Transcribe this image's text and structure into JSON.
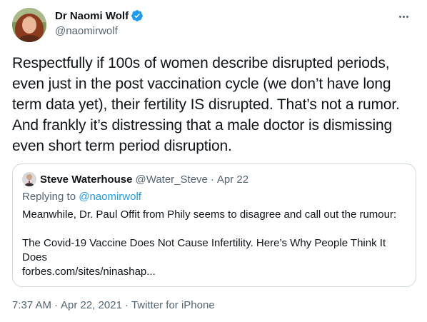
{
  "author": {
    "display_name": "Dr Naomi Wolf",
    "handle": "@naomirwolf",
    "verified_icon": "verified-badge-icon",
    "avatar": "avatar"
  },
  "tweet": {
    "text": "Respectfully if 100s of women describe disrupted periods, even just in the post vaccination cycle (we don’t have long term data yet), their fertility IS disrupted. That’s not a rumor. And frankly it’s distressing that a male doctor is dismissing even short term period disruption."
  },
  "quoted_tweet": {
    "display_name": "Steve Waterhouse",
    "handle": "@Water_Steve",
    "separator": "·",
    "date": "Apr 22",
    "replying_to_prefix": "Replying to",
    "replying_to_handle": "@naomirwolf",
    "body_line": "Meanwhile, Dr. Paul Offit from Phily seems to disagree and call out the rumour:",
    "link_title_line1": "The Covid-19 Vaccine Does Not Cause Infertility. Here’s Why People Think It",
    "link_title_line2": "Does",
    "link_url": "forbes.com/sites/ninashap..."
  },
  "footer": {
    "time": "7:37 AM",
    "separator": "·",
    "date": "Apr 22, 2021",
    "source": "Twitter for iPhone"
  },
  "colors": {
    "text": "#0f1419",
    "secondary": "#536471",
    "accent": "#1d9bf0",
    "border": "#cfd9de"
  }
}
